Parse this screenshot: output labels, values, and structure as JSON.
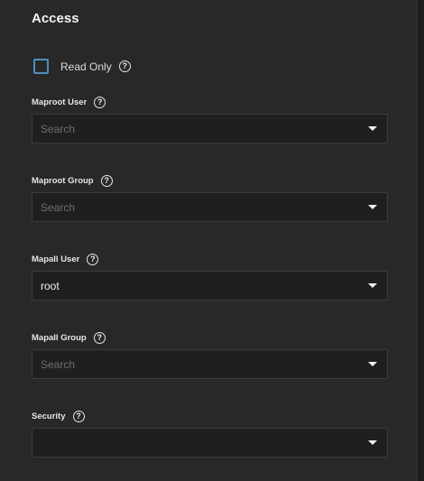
{
  "section": {
    "title": "Access"
  },
  "read_only": {
    "label": "Read Only",
    "checked": false,
    "help_icon": "help-circle-icon"
  },
  "fields": [
    {
      "label": "Maproot User",
      "value": "",
      "placeholder": "Search"
    },
    {
      "label": "Maproot Group",
      "value": "",
      "placeholder": "Search"
    },
    {
      "label": "Mapall User",
      "value": "root",
      "placeholder": ""
    },
    {
      "label": "Mapall Group",
      "value": "",
      "placeholder": "Search"
    },
    {
      "label": "Security",
      "value": "",
      "placeholder": ""
    }
  ],
  "colors": {
    "background": "#282828",
    "input_background": "#1f1f1f",
    "checkbox_border": "#4d8fbf",
    "text": "#e6e6e6",
    "placeholder": "#6f6f6f"
  }
}
